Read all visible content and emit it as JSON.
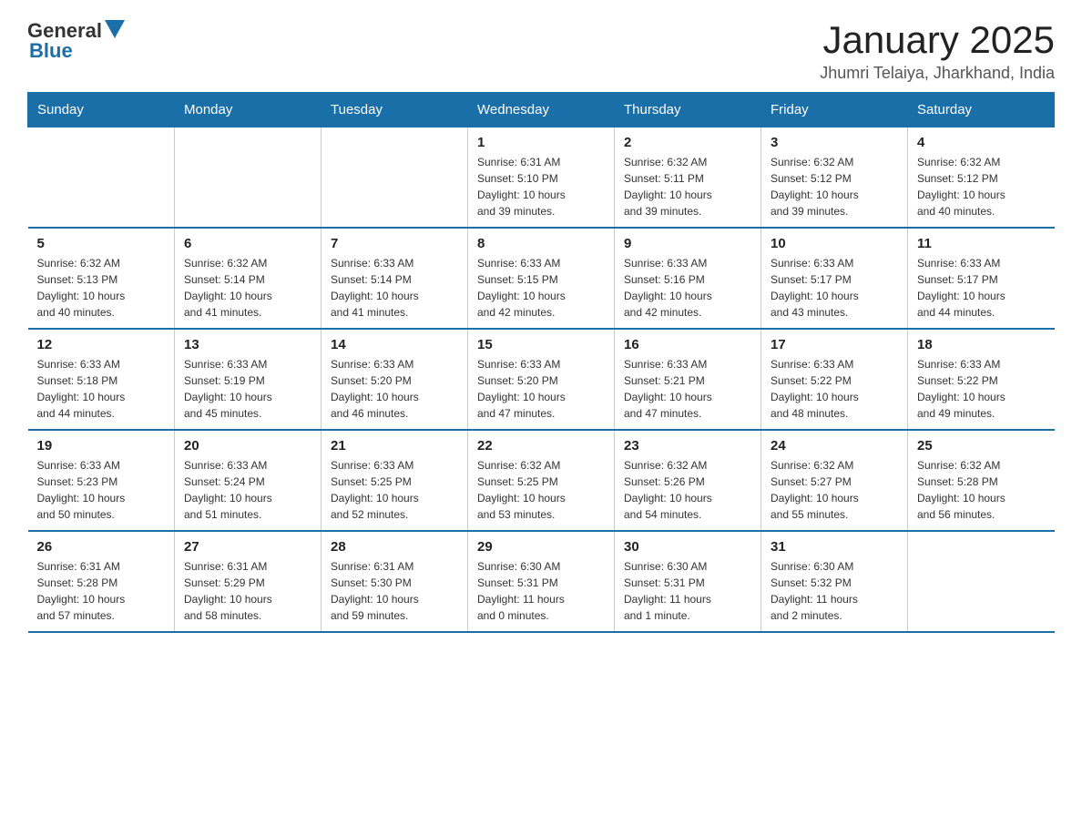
{
  "logo": {
    "general": "General",
    "blue": "Blue"
  },
  "header": {
    "month_title": "January 2025",
    "location": "Jhumri Telaiya, Jharkhand, India"
  },
  "days_of_week": [
    "Sunday",
    "Monday",
    "Tuesday",
    "Wednesday",
    "Thursday",
    "Friday",
    "Saturday"
  ],
  "weeks": [
    [
      {
        "day": "",
        "info": ""
      },
      {
        "day": "",
        "info": ""
      },
      {
        "day": "",
        "info": ""
      },
      {
        "day": "1",
        "info": "Sunrise: 6:31 AM\nSunset: 5:10 PM\nDaylight: 10 hours\nand 39 minutes."
      },
      {
        "day": "2",
        "info": "Sunrise: 6:32 AM\nSunset: 5:11 PM\nDaylight: 10 hours\nand 39 minutes."
      },
      {
        "day": "3",
        "info": "Sunrise: 6:32 AM\nSunset: 5:12 PM\nDaylight: 10 hours\nand 39 minutes."
      },
      {
        "day": "4",
        "info": "Sunrise: 6:32 AM\nSunset: 5:12 PM\nDaylight: 10 hours\nand 40 minutes."
      }
    ],
    [
      {
        "day": "5",
        "info": "Sunrise: 6:32 AM\nSunset: 5:13 PM\nDaylight: 10 hours\nand 40 minutes."
      },
      {
        "day": "6",
        "info": "Sunrise: 6:32 AM\nSunset: 5:14 PM\nDaylight: 10 hours\nand 41 minutes."
      },
      {
        "day": "7",
        "info": "Sunrise: 6:33 AM\nSunset: 5:14 PM\nDaylight: 10 hours\nand 41 minutes."
      },
      {
        "day": "8",
        "info": "Sunrise: 6:33 AM\nSunset: 5:15 PM\nDaylight: 10 hours\nand 42 minutes."
      },
      {
        "day": "9",
        "info": "Sunrise: 6:33 AM\nSunset: 5:16 PM\nDaylight: 10 hours\nand 42 minutes."
      },
      {
        "day": "10",
        "info": "Sunrise: 6:33 AM\nSunset: 5:17 PM\nDaylight: 10 hours\nand 43 minutes."
      },
      {
        "day": "11",
        "info": "Sunrise: 6:33 AM\nSunset: 5:17 PM\nDaylight: 10 hours\nand 44 minutes."
      }
    ],
    [
      {
        "day": "12",
        "info": "Sunrise: 6:33 AM\nSunset: 5:18 PM\nDaylight: 10 hours\nand 44 minutes."
      },
      {
        "day": "13",
        "info": "Sunrise: 6:33 AM\nSunset: 5:19 PM\nDaylight: 10 hours\nand 45 minutes."
      },
      {
        "day": "14",
        "info": "Sunrise: 6:33 AM\nSunset: 5:20 PM\nDaylight: 10 hours\nand 46 minutes."
      },
      {
        "day": "15",
        "info": "Sunrise: 6:33 AM\nSunset: 5:20 PM\nDaylight: 10 hours\nand 47 minutes."
      },
      {
        "day": "16",
        "info": "Sunrise: 6:33 AM\nSunset: 5:21 PM\nDaylight: 10 hours\nand 47 minutes."
      },
      {
        "day": "17",
        "info": "Sunrise: 6:33 AM\nSunset: 5:22 PM\nDaylight: 10 hours\nand 48 minutes."
      },
      {
        "day": "18",
        "info": "Sunrise: 6:33 AM\nSunset: 5:22 PM\nDaylight: 10 hours\nand 49 minutes."
      }
    ],
    [
      {
        "day": "19",
        "info": "Sunrise: 6:33 AM\nSunset: 5:23 PM\nDaylight: 10 hours\nand 50 minutes."
      },
      {
        "day": "20",
        "info": "Sunrise: 6:33 AM\nSunset: 5:24 PM\nDaylight: 10 hours\nand 51 minutes."
      },
      {
        "day": "21",
        "info": "Sunrise: 6:33 AM\nSunset: 5:25 PM\nDaylight: 10 hours\nand 52 minutes."
      },
      {
        "day": "22",
        "info": "Sunrise: 6:32 AM\nSunset: 5:25 PM\nDaylight: 10 hours\nand 53 minutes."
      },
      {
        "day": "23",
        "info": "Sunrise: 6:32 AM\nSunset: 5:26 PM\nDaylight: 10 hours\nand 54 minutes."
      },
      {
        "day": "24",
        "info": "Sunrise: 6:32 AM\nSunset: 5:27 PM\nDaylight: 10 hours\nand 55 minutes."
      },
      {
        "day": "25",
        "info": "Sunrise: 6:32 AM\nSunset: 5:28 PM\nDaylight: 10 hours\nand 56 minutes."
      }
    ],
    [
      {
        "day": "26",
        "info": "Sunrise: 6:31 AM\nSunset: 5:28 PM\nDaylight: 10 hours\nand 57 minutes."
      },
      {
        "day": "27",
        "info": "Sunrise: 6:31 AM\nSunset: 5:29 PM\nDaylight: 10 hours\nand 58 minutes."
      },
      {
        "day": "28",
        "info": "Sunrise: 6:31 AM\nSunset: 5:30 PM\nDaylight: 10 hours\nand 59 minutes."
      },
      {
        "day": "29",
        "info": "Sunrise: 6:30 AM\nSunset: 5:31 PM\nDaylight: 11 hours\nand 0 minutes."
      },
      {
        "day": "30",
        "info": "Sunrise: 6:30 AM\nSunset: 5:31 PM\nDaylight: 11 hours\nand 1 minute."
      },
      {
        "day": "31",
        "info": "Sunrise: 6:30 AM\nSunset: 5:32 PM\nDaylight: 11 hours\nand 2 minutes."
      },
      {
        "day": "",
        "info": ""
      }
    ]
  ]
}
